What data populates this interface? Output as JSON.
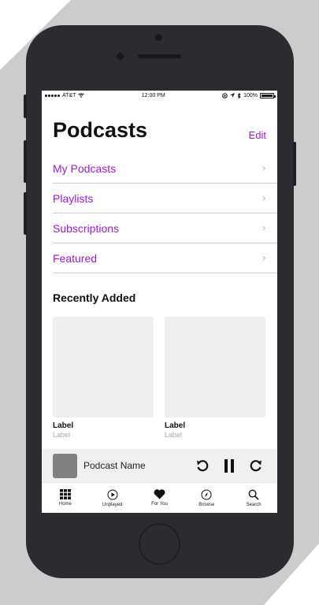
{
  "status": {
    "carrier": "AT&T",
    "time": "12:00 PM",
    "battery": "100%"
  },
  "header": {
    "title": "Podcasts",
    "edit_label": "Edit"
  },
  "menu": [
    {
      "label": "My Podcasts"
    },
    {
      "label": "Playlists"
    },
    {
      "label": "Subscriptions"
    },
    {
      "label": "Featured"
    }
  ],
  "recent": {
    "title": "Recently Added",
    "items": [
      {
        "title": "Label",
        "subtitle": "Label"
      },
      {
        "title": "Label",
        "subtitle": "Label"
      }
    ]
  },
  "player": {
    "name": "Podcast Name",
    "icons": [
      "rewind-icon",
      "pause-icon",
      "forward-icon"
    ]
  },
  "tabs": [
    {
      "label": "Home",
      "icon": "grid-icon"
    },
    {
      "label": "Unplayed",
      "icon": "play-circle-icon"
    },
    {
      "label": "For You",
      "icon": "heart-icon"
    },
    {
      "label": "Browse",
      "icon": "compass-icon"
    },
    {
      "label": "Search",
      "icon": "search-icon"
    }
  ],
  "colors": {
    "accent": "#9b19d8",
    "phone": "#2b2c31",
    "shadow": "#cccccc"
  }
}
